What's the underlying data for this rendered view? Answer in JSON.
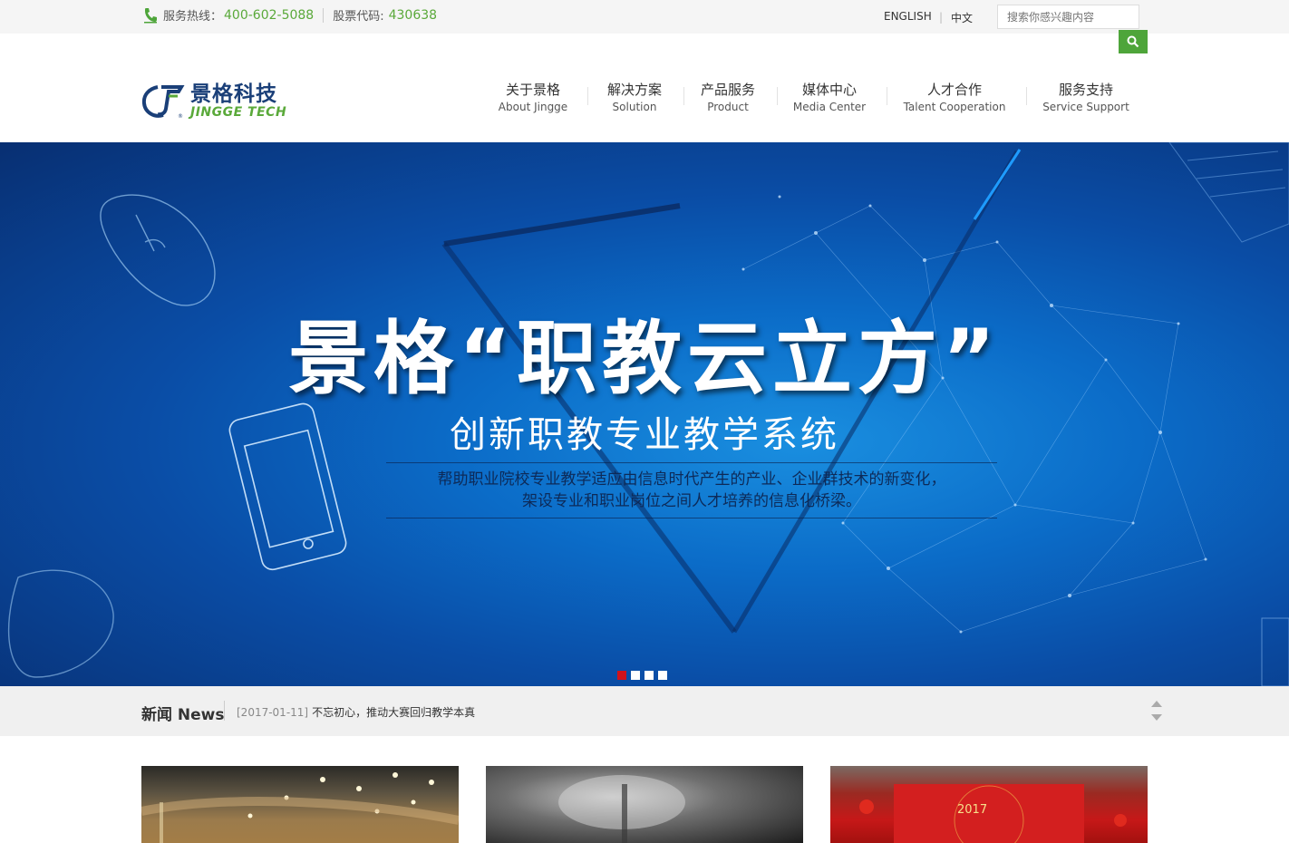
{
  "topbar": {
    "hotline_label": "服务热线：",
    "hotline_number": "400-602-5088",
    "stock_label": "股票代码:",
    "stock_code": "430638",
    "lang_en": "ENGLISH",
    "lang_sep": "|",
    "lang_cn": "中文",
    "search_placeholder": "搜索你感兴趣内容"
  },
  "logo": {
    "cn": "景格科技",
    "en": "JINGGE TECH"
  },
  "nav": [
    {
      "cn": "关于景格",
      "en": "About Jingge"
    },
    {
      "cn": "解决方案",
      "en": "Solution"
    },
    {
      "cn": "产品服务",
      "en": "Product"
    },
    {
      "cn": "媒体中心",
      "en": "Media Center"
    },
    {
      "cn": "人才合作",
      "en": "Talent Cooperation"
    },
    {
      "cn": "服务支持",
      "en": "Service Support"
    }
  ],
  "banner": {
    "headline": "景格“职教云立方”",
    "subheadline": "创新职教专业教学系统",
    "desc_line1": "帮助职业院校专业教学适应由信息时代产生的产业、企业群技术的新变化，",
    "desc_line2": "架设专业和职业岗位之间人才培养的信息化桥梁。",
    "slides": 4,
    "active_slide": 1
  },
  "news": {
    "title": "新闻 News",
    "date": "[2017-01-11]",
    "headline": "不忘初心，推动大赛回归教学本真"
  },
  "colors": {
    "accent": "#5aa93a",
    "brand_blue": "#1a3f78",
    "banner_dot_active": "#d0121b"
  }
}
